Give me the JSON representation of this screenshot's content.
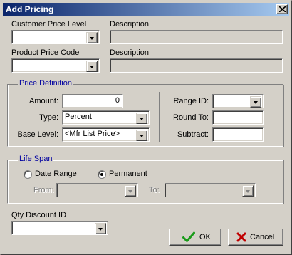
{
  "window": {
    "title": "Add Pricing"
  },
  "customer_price_level": {
    "label": "Customer Price Level",
    "value": "",
    "description_label": "Description",
    "description_value": ""
  },
  "product_price_code": {
    "label": "Product Price Code",
    "value": "",
    "description_label": "Description",
    "description_value": ""
  },
  "price_definition": {
    "title": "Price Definition",
    "amount_label": "Amount:",
    "amount_value": "0",
    "type_label": "Type:",
    "type_value": "Percent",
    "base_level_label": "Base Level:",
    "base_level_value": "<Mfr List Price>",
    "range_id_label": "Range ID:",
    "range_id_value": "",
    "round_to_label": "Round To:",
    "round_to_value": "",
    "subtract_label": "Subtract:",
    "subtract_value": ""
  },
  "life_span": {
    "title": "Life Span",
    "date_range_label": "Date Range",
    "permanent_label": "Permanent",
    "selected": "Permanent",
    "from_label": "From:",
    "from_value": "",
    "to_label": "To:",
    "to_value": ""
  },
  "qty_discount": {
    "label": "Qty Discount ID",
    "value": ""
  },
  "buttons": {
    "ok_label": "OK",
    "cancel_label": "Cancel"
  },
  "colors": {
    "titlebar_start": "#0a246a",
    "titlebar_end": "#a6caf0",
    "group_title": "#0000a0",
    "ok_check": "#1a9b1a",
    "cancel_x": "#c00000"
  }
}
